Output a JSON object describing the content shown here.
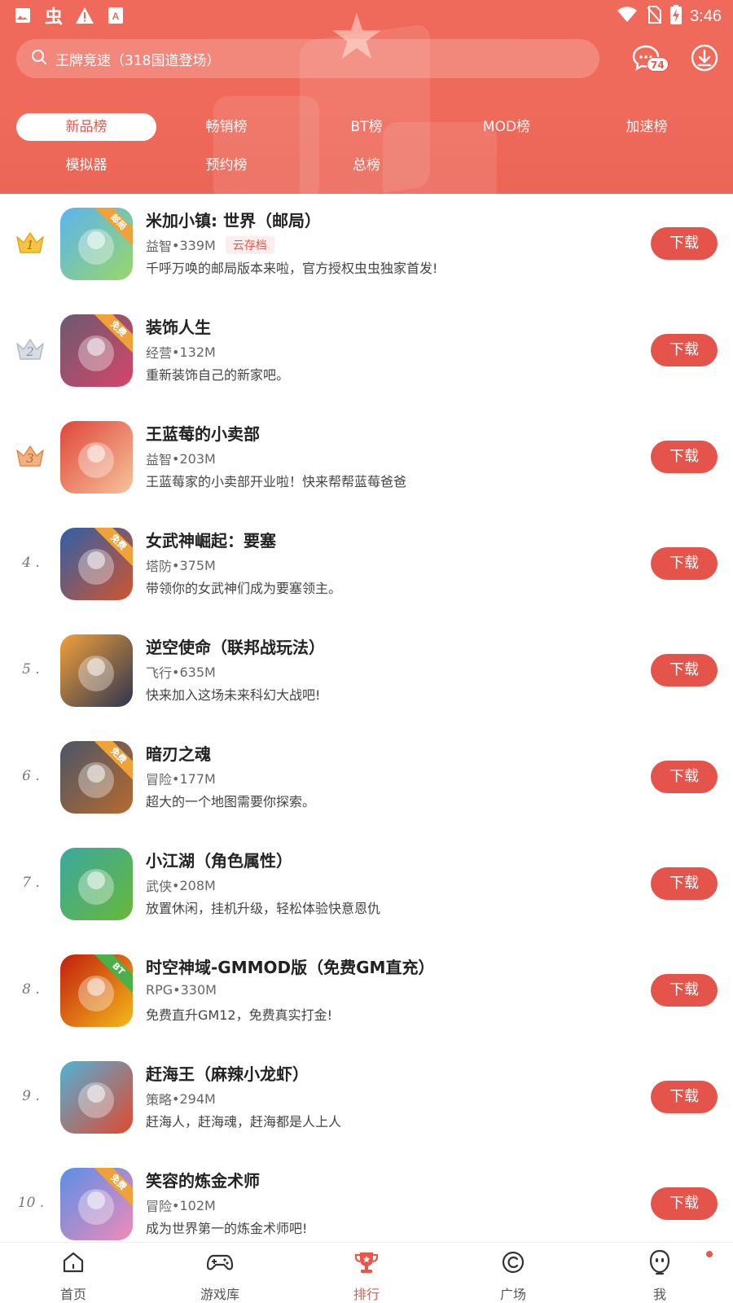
{
  "status_bar": {
    "time": "3:46",
    "left_icons": [
      "image-icon",
      "bug-app-icon",
      "warning-icon",
      "a-app-icon"
    ],
    "right_icons": [
      "wifi-icon",
      "no-sim-icon",
      "battery-charging-icon"
    ]
  },
  "header": {
    "search_placeholder": "王牌竞速（318国道登场）",
    "message_badge": "74",
    "brand_color": "#ef6a5b"
  },
  "tabs": [
    {
      "label": "新品榜",
      "active": true
    },
    {
      "label": "畅销榜"
    },
    {
      "label": "BT榜"
    },
    {
      "label": "MOD榜"
    },
    {
      "label": "加速榜"
    },
    {
      "label": "模拟器"
    },
    {
      "label": "预约榜"
    },
    {
      "label": "总榜"
    }
  ],
  "list": [
    {
      "rank": "1",
      "crown": "gold",
      "title": "米加小镇: 世界（邮局）",
      "category": "益智",
      "size": "339M",
      "tag": "云存档",
      "desc": "千呼万唤的邮局版本来啦，官方授权虫虫独家首发!",
      "button": "下载",
      "ribbon": "邮局",
      "icon_colors": [
        "#5ab4f0",
        "#9ad66a"
      ]
    },
    {
      "rank": "2",
      "crown": "silver",
      "title": "装饰人生",
      "category": "经营",
      "size": "132M",
      "desc": "重新装饰自己的新家吧。",
      "button": "下载",
      "ribbon": "免费",
      "icon_colors": [
        "#6b5a70",
        "#d6456a"
      ]
    },
    {
      "rank": "3",
      "crown": "bronze",
      "title": "王蓝莓的小卖部",
      "category": "益智",
      "size": "203M",
      "desc": "王蓝莓家的小卖部开业啦！快来帮帮蓝莓爸爸",
      "button": "下载",
      "icon_colors": [
        "#e0453a",
        "#f6c39a"
      ]
    },
    {
      "rank": "4",
      "title": "女武神崛起：要塞",
      "category": "塔防",
      "size": "375M",
      "desc": "带领你的女武神们成为要塞领主。",
      "button": "下载",
      "ribbon": "免费",
      "icon_colors": [
        "#2f5fa8",
        "#d0552e"
      ]
    },
    {
      "rank": "5",
      "title": "逆空使命（联邦战玩法）",
      "category": "飞行",
      "size": "635M",
      "desc": "快来加入这场未来科幻大战吧!",
      "button": "下载",
      "ribbon": "",
      "icon_colors": [
        "#f2a03a",
        "#2e3550"
      ]
    },
    {
      "rank": "6",
      "title": "暗刃之魂",
      "category": "冒险",
      "size": "177M",
      "desc": "超大的一个地图需要你探索。",
      "button": "下载",
      "ribbon": "免费",
      "icon_colors": [
        "#4a5568",
        "#b86a2e"
      ]
    },
    {
      "rank": "7",
      "title": "小江湖（角色属性）",
      "category": "武侠",
      "size": "208M",
      "desc": "放置休闲，挂机升级，轻松体验快意恩仇",
      "button": "下载",
      "icon_colors": [
        "#3aa8a0",
        "#68b83a"
      ]
    },
    {
      "rank": "8",
      "title": "时空神域-GMMOD版（免费GM直充）",
      "category": "RPG",
      "size": "330M",
      "desc": "免费直升GM12，免费真实打金!",
      "button": "下载",
      "ribbon": "BT",
      "icon_colors": [
        "#c21e0e",
        "#f5b81a"
      ]
    },
    {
      "rank": "9",
      "title": "赶海王（麻辣小龙虾）",
      "category": "策略",
      "size": "294M",
      "desc": "赶海人，赶海魂，赶海都是人上人",
      "button": "下载",
      "icon_colors": [
        "#4fb2d8",
        "#e0492e"
      ]
    },
    {
      "rank": "10",
      "title": "笑容的炼金术师",
      "category": "冒险",
      "size": "102M",
      "desc": "成为世界第一的炼金术师吧!",
      "button": "下载",
      "ribbon": "免费",
      "icon_colors": [
        "#5a8fe8",
        "#f08ab8"
      ]
    }
  ],
  "bottom_nav": [
    {
      "label": "首页",
      "icon": "home-icon"
    },
    {
      "label": "游戏库",
      "icon": "gamepad-icon"
    },
    {
      "label": "排行",
      "icon": "trophy-icon",
      "active": true
    },
    {
      "label": "广场",
      "icon": "discover-icon"
    },
    {
      "label": "我",
      "icon": "profile-face-icon"
    }
  ]
}
